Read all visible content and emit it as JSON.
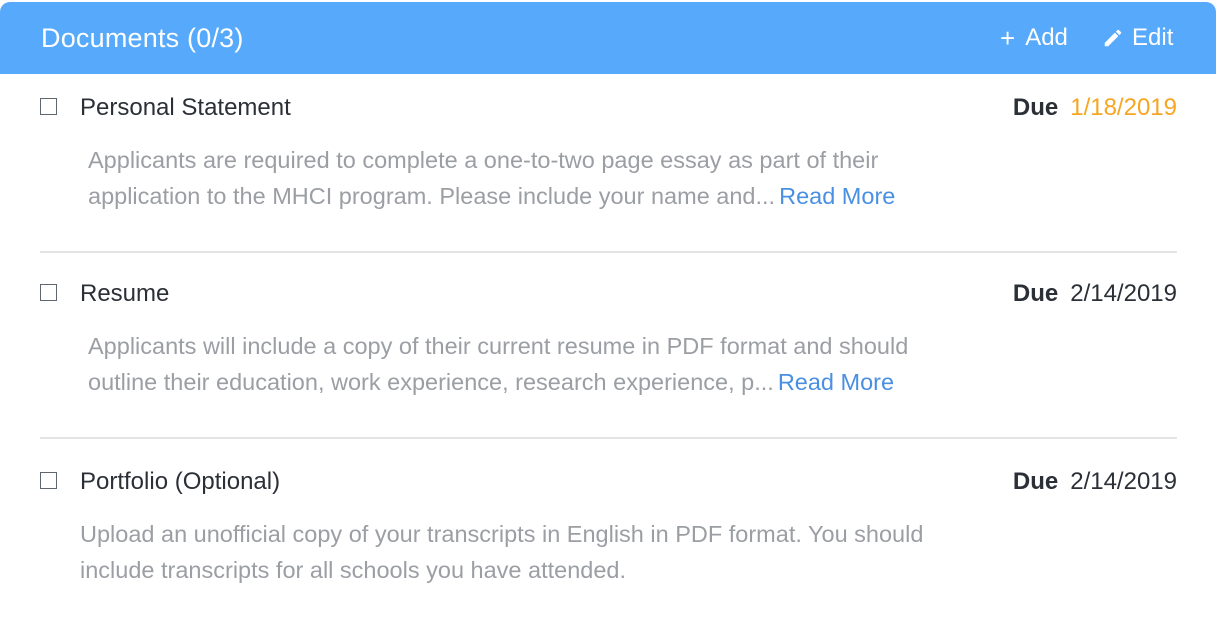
{
  "header": {
    "title": "Documents (0/3)",
    "add_label": "Add",
    "edit_label": "Edit",
    "background_color": "#56a9fb"
  },
  "documents": [
    {
      "title": "Personal Statement",
      "due_label": "Due",
      "due_date": "1/18/2019",
      "due_color": "#f5a623",
      "checked": false,
      "description_line1": "Applicants are required to complete a one-to-two page essay as part of their",
      "description_line2": "application to the MHCI program. Please include your name and...",
      "read_more": "Read More"
    },
    {
      "title": "Resume",
      "due_label": "Due",
      "due_date": "2/14/2019",
      "checked": false,
      "description_line1": "Applicants will include a copy of their current resume in PDF format and should",
      "description_line2": "outline their education, work experience, research experience, p...",
      "read_more": "Read More"
    },
    {
      "title": "Portfolio (Optional)",
      "due_label": "Due",
      "due_date": "2/14/2019",
      "checked": false,
      "description_line1": "Upload an unofficial copy of your transcripts in English in PDF format. You should",
      "description_line2": "include transcripts for all schools you have attended."
    }
  ],
  "icons": {
    "add": "plus-icon",
    "edit": "pencil-icon",
    "checkbox": "checkbox-unchecked"
  }
}
